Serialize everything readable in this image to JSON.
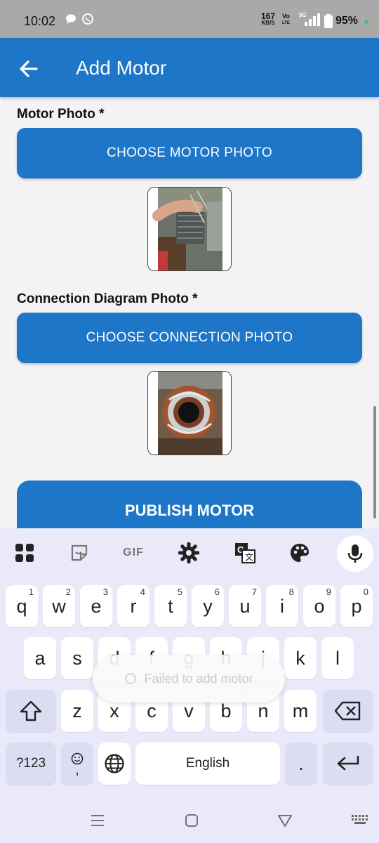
{
  "status_bar": {
    "time": "10:02",
    "speed_value": "167",
    "speed_unit": "KB/S",
    "volte_top": "Vo",
    "volte_bottom": "LTE",
    "network": "5G",
    "battery": "95%"
  },
  "app_bar": {
    "title": "Add Motor"
  },
  "form": {
    "motor_photo_label": "Motor Photo *",
    "motor_photo_button": "CHOOSE MOTOR PHOTO",
    "connection_label": "Connection Diagram Photo *",
    "connection_button": "CHOOSE CONNECTION PHOTO",
    "publish_button": "PUBLISH MOTOR"
  },
  "keyboard": {
    "toolbar": [
      "apps-icon",
      "sticker-icon",
      "GIF",
      "settings-icon",
      "translate-icon",
      "palette-icon",
      "mic-icon"
    ],
    "gif_label": "GIF",
    "row1": [
      {
        "key": "q",
        "hint": "1"
      },
      {
        "key": "w",
        "hint": "2"
      },
      {
        "key": "e",
        "hint": "3"
      },
      {
        "key": "r",
        "hint": "4"
      },
      {
        "key": "t",
        "hint": "5"
      },
      {
        "key": "y",
        "hint": "6"
      },
      {
        "key": "u",
        "hint": "7"
      },
      {
        "key": "i",
        "hint": "8"
      },
      {
        "key": "o",
        "hint": "9"
      },
      {
        "key": "p",
        "hint": "0"
      }
    ],
    "row2": [
      "a",
      "s",
      "d",
      "f",
      "g",
      "h",
      "j",
      "k",
      "l"
    ],
    "row3": [
      "z",
      "x",
      "c",
      "v",
      "b",
      "n",
      "m"
    ],
    "symbols_key": "?123",
    "emoji_key_bottom": ",",
    "space_label": "English",
    "period_key": "."
  },
  "toast": {
    "message": "Failed to add motor"
  },
  "colors": {
    "primary": "#1d76c7",
    "status_bar": "#a9a9a9",
    "keyboard_bg": "#e9e9f9",
    "battery_dot": "#3fc46a"
  }
}
